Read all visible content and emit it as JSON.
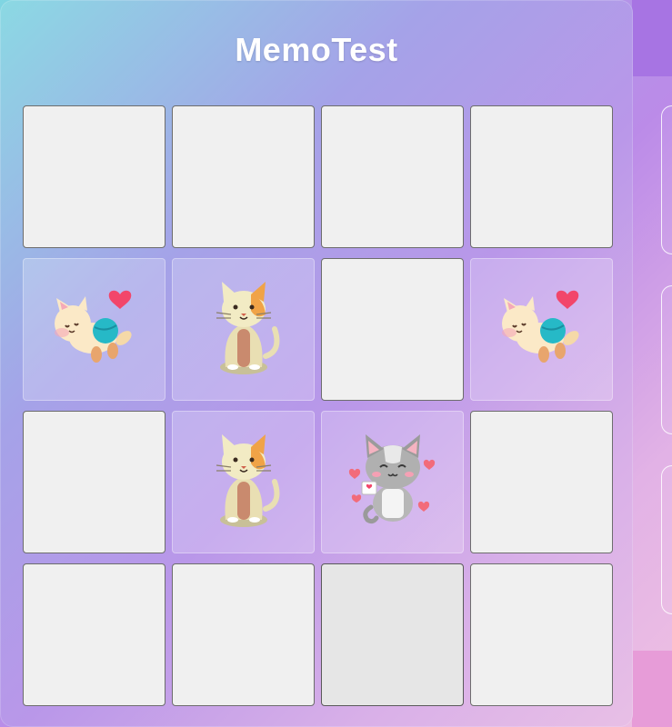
{
  "header": {
    "title": "MemoTest"
  },
  "board": {
    "cards": [
      {
        "state": "hidden",
        "image": ""
      },
      {
        "state": "hidden",
        "image": ""
      },
      {
        "state": "hidden",
        "image": ""
      },
      {
        "state": "hidden",
        "image": ""
      },
      {
        "state": "revealed",
        "image": "cat-with-yarn-ball-heart"
      },
      {
        "state": "revealed",
        "image": "sitting-calico-cat"
      },
      {
        "state": "hidden",
        "image": ""
      },
      {
        "state": "revealed",
        "image": "cat-with-yarn-ball-heart"
      },
      {
        "state": "hidden",
        "image": ""
      },
      {
        "state": "revealed",
        "image": "sitting-calico-cat"
      },
      {
        "state": "revealed",
        "image": "gray-cat-with-hearts-letter"
      },
      {
        "state": "hidden",
        "image": ""
      },
      {
        "state": "hidden",
        "image": ""
      },
      {
        "state": "hidden",
        "image": ""
      },
      {
        "state": "hover",
        "image": ""
      },
      {
        "state": "hidden",
        "image": ""
      }
    ]
  },
  "colors": {
    "card_back": "#f0f0f0",
    "card_border": "#6d6d6d",
    "title_text": "#ffffff"
  }
}
